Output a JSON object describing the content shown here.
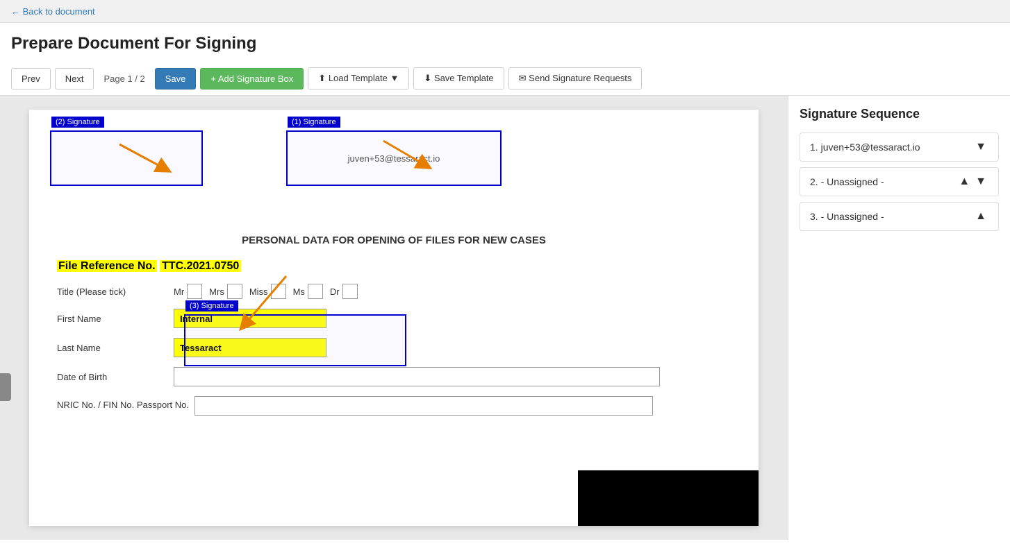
{
  "topbar": {
    "back_label": "← Back to document"
  },
  "header": {
    "title": "Prepare Document For Signing"
  },
  "toolbar": {
    "prev_label": "Prev",
    "next_label": "Next",
    "page_info": "Page 1 / 2",
    "save_label": "Save",
    "add_sig_label": "+ Add Signature Box",
    "load_template_label": "Load Template",
    "save_template_label": "Save Template",
    "send_requests_label": "✉ Send Signature Requests"
  },
  "signature_boxes": [
    {
      "id": 1,
      "label": "(1) Signature",
      "content": "juven+53@tessaract.io"
    },
    {
      "id": 2,
      "label": "(2) Signature",
      "content": ""
    },
    {
      "id": 3,
      "label": "(3) Signature",
      "content": ""
    }
  ],
  "document": {
    "header": "PERSONAL DATA FOR OPENING OF FILES FOR NEW CASES",
    "file_ref_label": "File Reference No.",
    "file_ref_value": "TTC.2021.0750",
    "title_label": "Title (Please tick)",
    "title_options": [
      "Mr",
      "Mrs",
      "Miss",
      "Ms",
      "Dr"
    ],
    "first_name_label": "First Name",
    "first_name_value": "Internal",
    "last_name_label": "Last Name",
    "last_name_value": "Tessaract",
    "dob_label": "Date of Birth",
    "nric_label": "NRIC No. / FIN No. Passport No."
  },
  "sidebar": {
    "title": "Signature Sequence",
    "items": [
      {
        "num": "1.",
        "label": "juven+53@tessaract.io",
        "controls": [
          "▼"
        ]
      },
      {
        "num": "2.",
        "label": "- Unassigned -",
        "controls": [
          "▲",
          "▼"
        ]
      },
      {
        "num": "3.",
        "label": "- Unassigned -",
        "controls": [
          "▲"
        ]
      }
    ]
  }
}
